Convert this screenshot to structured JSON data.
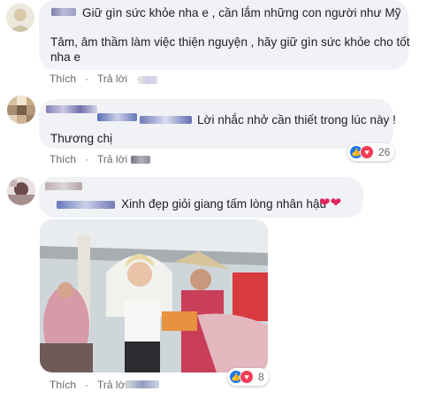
{
  "comments": [
    {
      "text_line1": "Giữ gìn sức khỏe nha e , cần lắm những con người như Mỹ",
      "text_line2": "Tâm, âm thầm làm việc thiện nguyện , hãy giữ gìn sức khỏe cho tốt",
      "text_line3": "nha e",
      "actions": {
        "like": "Thích",
        "reply": "Trả lời"
      }
    },
    {
      "text_line1": "Lời nhắc nhở cần thiết trong lúc này !",
      "text_line2": "Thương chị",
      "actions": {
        "like": "Thích",
        "reply": "Trả lời"
      },
      "reactions": {
        "icons": [
          "like-icon",
          "love-icon"
        ],
        "count": "26"
      }
    },
    {
      "text": "Xinh đẹp giỏi giang tấm lòng nhân hậu",
      "hearts": "❤❤",
      "actions": {
        "like": "Thích",
        "reply": "Trả lời"
      },
      "reactions": {
        "icons": [
          "like-icon",
          "love-icon"
        ],
        "count": "8"
      }
    }
  ],
  "colors": {
    "bubble": "#f0f2f5",
    "action_text": "#65676b",
    "like_blue": "#1877f2",
    "love_red": "#f33e58"
  }
}
